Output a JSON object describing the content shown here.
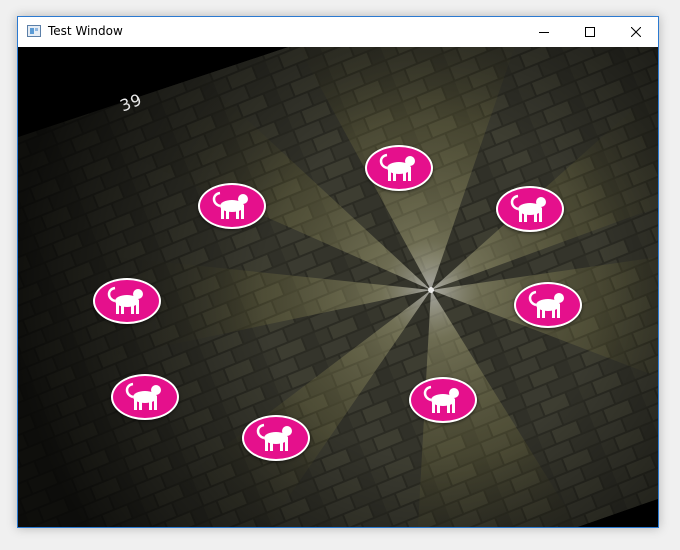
{
  "window": {
    "title": "Test Window",
    "controls": {
      "minimize": "minimize-icon",
      "maximize": "maximize-icon",
      "close": "close-icon"
    }
  },
  "game": {
    "counter": "39",
    "token_color": "#e5108c",
    "token_icon": "monkey-icon",
    "token_count": 8
  }
}
